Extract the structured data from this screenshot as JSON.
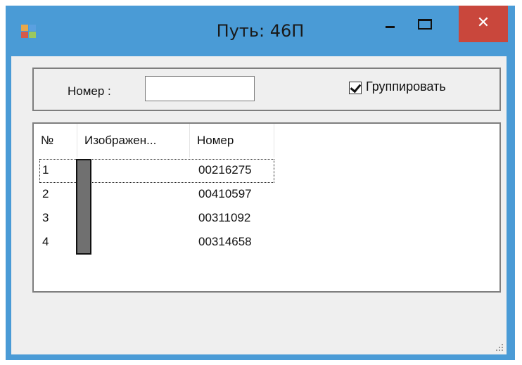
{
  "window": {
    "title": "Путь: 46П",
    "icon": "app-window-icon",
    "close_glyph": "✕"
  },
  "filter": {
    "number_label": "Номер :",
    "number_value": "",
    "group_label": "Группировать",
    "group_checked": true
  },
  "list": {
    "columns": [
      "№",
      "Изображен...",
      "Номер"
    ],
    "rows": [
      {
        "num": "1",
        "code": "00216275"
      },
      {
        "num": "2",
        "code": "00410597"
      },
      {
        "num": "3",
        "code": "00311092"
      },
      {
        "num": "4",
        "code": "00314658"
      }
    ]
  },
  "colors": {
    "window_border": "#4a9bd6",
    "close_button": "#c9473c",
    "client_bg": "#efefef"
  }
}
